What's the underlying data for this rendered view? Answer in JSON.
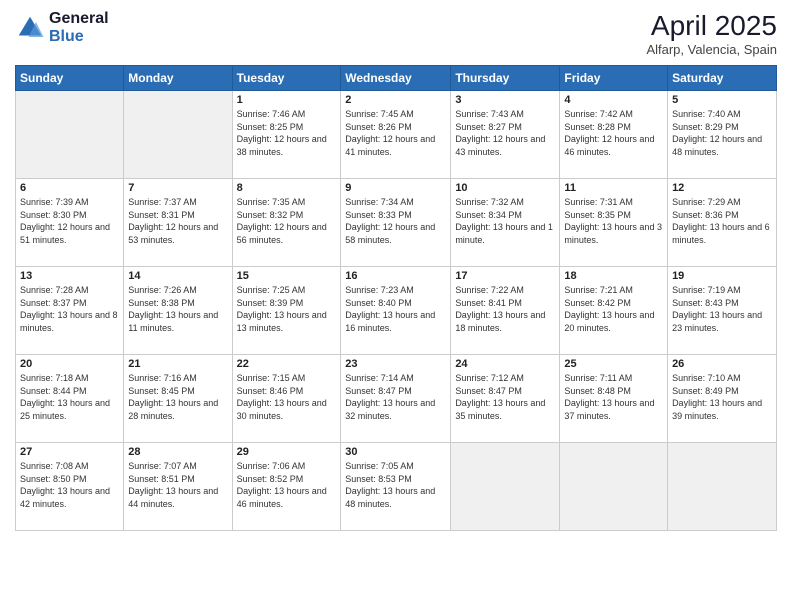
{
  "header": {
    "logo_general": "General",
    "logo_blue": "Blue",
    "title": "April 2025",
    "location": "Alfarp, Valencia, Spain"
  },
  "days_of_week": [
    "Sunday",
    "Monday",
    "Tuesday",
    "Wednesday",
    "Thursday",
    "Friday",
    "Saturday"
  ],
  "weeks": [
    [
      {
        "day": "",
        "info": ""
      },
      {
        "day": "",
        "info": ""
      },
      {
        "day": "1",
        "info": "Sunrise: 7:46 AM\nSunset: 8:25 PM\nDaylight: 12 hours and 38 minutes."
      },
      {
        "day": "2",
        "info": "Sunrise: 7:45 AM\nSunset: 8:26 PM\nDaylight: 12 hours and 41 minutes."
      },
      {
        "day": "3",
        "info": "Sunrise: 7:43 AM\nSunset: 8:27 PM\nDaylight: 12 hours and 43 minutes."
      },
      {
        "day": "4",
        "info": "Sunrise: 7:42 AM\nSunset: 8:28 PM\nDaylight: 12 hours and 46 minutes."
      },
      {
        "day": "5",
        "info": "Sunrise: 7:40 AM\nSunset: 8:29 PM\nDaylight: 12 hours and 48 minutes."
      }
    ],
    [
      {
        "day": "6",
        "info": "Sunrise: 7:39 AM\nSunset: 8:30 PM\nDaylight: 12 hours and 51 minutes."
      },
      {
        "day": "7",
        "info": "Sunrise: 7:37 AM\nSunset: 8:31 PM\nDaylight: 12 hours and 53 minutes."
      },
      {
        "day": "8",
        "info": "Sunrise: 7:35 AM\nSunset: 8:32 PM\nDaylight: 12 hours and 56 minutes."
      },
      {
        "day": "9",
        "info": "Sunrise: 7:34 AM\nSunset: 8:33 PM\nDaylight: 12 hours and 58 minutes."
      },
      {
        "day": "10",
        "info": "Sunrise: 7:32 AM\nSunset: 8:34 PM\nDaylight: 13 hours and 1 minute."
      },
      {
        "day": "11",
        "info": "Sunrise: 7:31 AM\nSunset: 8:35 PM\nDaylight: 13 hours and 3 minutes."
      },
      {
        "day": "12",
        "info": "Sunrise: 7:29 AM\nSunset: 8:36 PM\nDaylight: 13 hours and 6 minutes."
      }
    ],
    [
      {
        "day": "13",
        "info": "Sunrise: 7:28 AM\nSunset: 8:37 PM\nDaylight: 13 hours and 8 minutes."
      },
      {
        "day": "14",
        "info": "Sunrise: 7:26 AM\nSunset: 8:38 PM\nDaylight: 13 hours and 11 minutes."
      },
      {
        "day": "15",
        "info": "Sunrise: 7:25 AM\nSunset: 8:39 PM\nDaylight: 13 hours and 13 minutes."
      },
      {
        "day": "16",
        "info": "Sunrise: 7:23 AM\nSunset: 8:40 PM\nDaylight: 13 hours and 16 minutes."
      },
      {
        "day": "17",
        "info": "Sunrise: 7:22 AM\nSunset: 8:41 PM\nDaylight: 13 hours and 18 minutes."
      },
      {
        "day": "18",
        "info": "Sunrise: 7:21 AM\nSunset: 8:42 PM\nDaylight: 13 hours and 20 minutes."
      },
      {
        "day": "19",
        "info": "Sunrise: 7:19 AM\nSunset: 8:43 PM\nDaylight: 13 hours and 23 minutes."
      }
    ],
    [
      {
        "day": "20",
        "info": "Sunrise: 7:18 AM\nSunset: 8:44 PM\nDaylight: 13 hours and 25 minutes."
      },
      {
        "day": "21",
        "info": "Sunrise: 7:16 AM\nSunset: 8:45 PM\nDaylight: 13 hours and 28 minutes."
      },
      {
        "day": "22",
        "info": "Sunrise: 7:15 AM\nSunset: 8:46 PM\nDaylight: 13 hours and 30 minutes."
      },
      {
        "day": "23",
        "info": "Sunrise: 7:14 AM\nSunset: 8:47 PM\nDaylight: 13 hours and 32 minutes."
      },
      {
        "day": "24",
        "info": "Sunrise: 7:12 AM\nSunset: 8:47 PM\nDaylight: 13 hours and 35 minutes."
      },
      {
        "day": "25",
        "info": "Sunrise: 7:11 AM\nSunset: 8:48 PM\nDaylight: 13 hours and 37 minutes."
      },
      {
        "day": "26",
        "info": "Sunrise: 7:10 AM\nSunset: 8:49 PM\nDaylight: 13 hours and 39 minutes."
      }
    ],
    [
      {
        "day": "27",
        "info": "Sunrise: 7:08 AM\nSunset: 8:50 PM\nDaylight: 13 hours and 42 minutes."
      },
      {
        "day": "28",
        "info": "Sunrise: 7:07 AM\nSunset: 8:51 PM\nDaylight: 13 hours and 44 minutes."
      },
      {
        "day": "29",
        "info": "Sunrise: 7:06 AM\nSunset: 8:52 PM\nDaylight: 13 hours and 46 minutes."
      },
      {
        "day": "30",
        "info": "Sunrise: 7:05 AM\nSunset: 8:53 PM\nDaylight: 13 hours and 48 minutes."
      },
      {
        "day": "",
        "info": ""
      },
      {
        "day": "",
        "info": ""
      },
      {
        "day": "",
        "info": ""
      }
    ]
  ]
}
